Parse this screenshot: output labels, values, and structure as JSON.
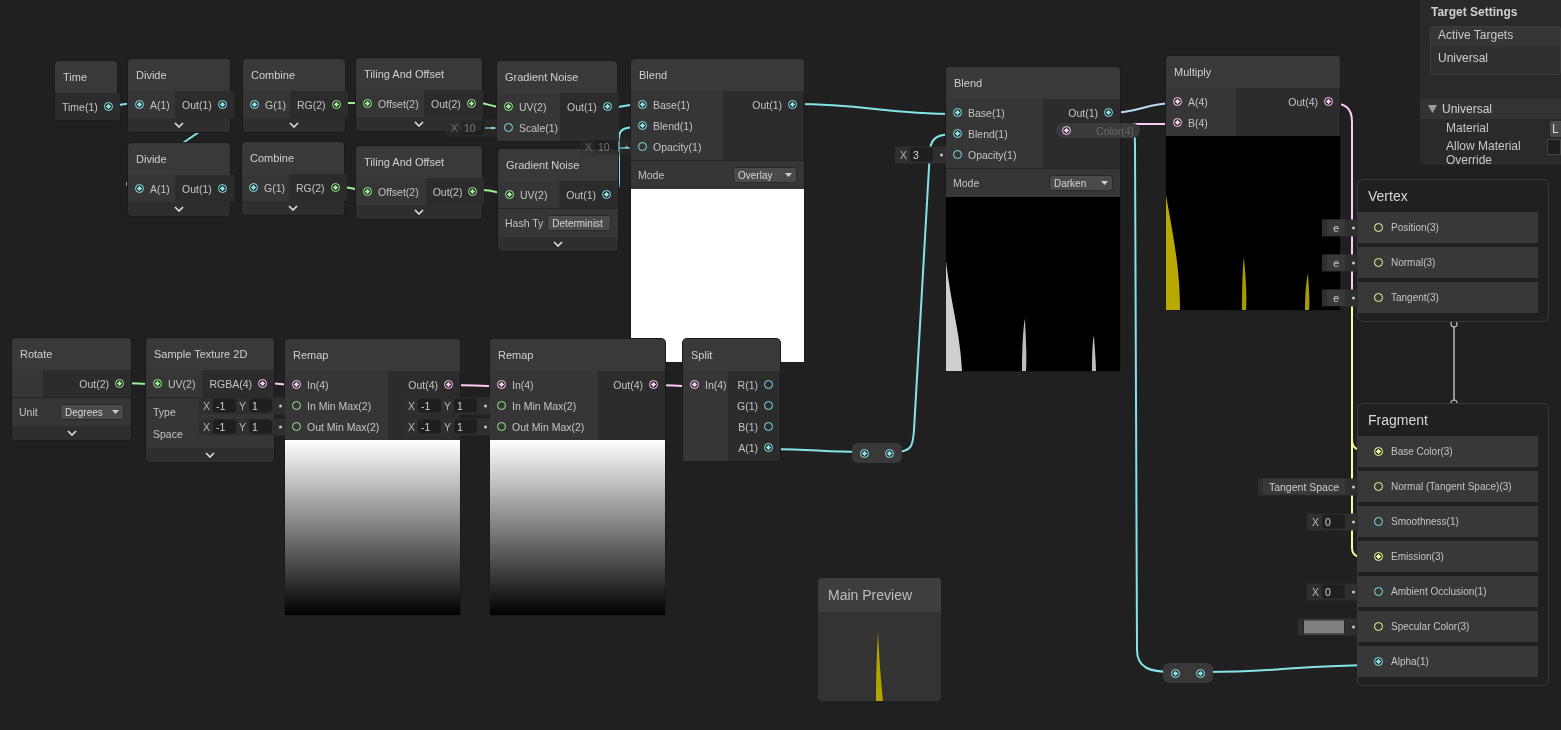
{
  "graph": {
    "nodes": [
      {
        "title": "Time",
        "outputs": [
          {
            "label": "Time(1)",
            "kind": "float",
            "connected": true
          }
        ],
        "expander": false
      },
      {
        "title": "Divide",
        "inputs": [
          {
            "label": "A(1)",
            "kind": "float",
            "connected": true
          }
        ],
        "outputs": [
          {
            "label": "Out(1)",
            "kind": "float",
            "connected": true
          }
        ],
        "expander": true
      },
      {
        "title": "Combine",
        "inputs": [
          {
            "label": "G(1)",
            "kind": "float",
            "connected": true
          }
        ],
        "outputs": [
          {
            "label": "RG(2)",
            "kind": "vec2",
            "connected": true
          }
        ],
        "expander": true
      },
      {
        "title": "Tiling And Offset",
        "inputs": [
          {
            "label": "Offset(2)",
            "kind": "vec2",
            "connected": true
          }
        ],
        "outputs": [
          {
            "label": "Out(2)",
            "kind": "vec2",
            "connected": true
          }
        ],
        "expander": true
      },
      {
        "title": "Gradient Noise",
        "inputs": [
          {
            "label": "UV(2)",
            "kind": "vec2",
            "connected": true
          },
          {
            "label": "Scale(1)",
            "kind": "float",
            "connected": false,
            "field": {
              "kind": "vector",
              "dimmed": true,
              "parts": [
                {
                  "axis": "X",
                  "value": "10"
                }
              ]
            }
          }
        ],
        "outputs": [
          {
            "label": "Out(1)",
            "kind": "float",
            "connected": true
          }
        ],
        "expander": false
      },
      {
        "title": "Blend",
        "inputs": [
          {
            "label": "Base(1)",
            "kind": "float",
            "connected": true
          },
          {
            "label": "Blend(1)",
            "kind": "float",
            "connected": true
          },
          {
            "label": "Opacity(1)",
            "kind": "float",
            "connected": false,
            "field": {
              "kind": "vector",
              "dimmed": true,
              "parts": [
                {
                  "axis": "X",
                  "value": "10"
                }
              ]
            }
          }
        ],
        "outputs": [
          {
            "label": "Out(1)",
            "kind": "float",
            "connected": true
          }
        ],
        "controls": [
          {
            "label": "Mode",
            "value": "Overlay"
          }
        ],
        "preview": {
          "kind": "white"
        },
        "expander": false
      },
      {
        "title": "Divide",
        "inputs": [
          {
            "label": "A(1)",
            "kind": "float",
            "connected": true
          }
        ],
        "outputs": [
          {
            "label": "Out(1)",
            "kind": "float",
            "connected": true
          }
        ],
        "expander": true
      },
      {
        "title": "Combine",
        "inputs": [
          {
            "label": "G(1)",
            "kind": "float",
            "connected": true
          }
        ],
        "outputs": [
          {
            "label": "RG(2)",
            "kind": "vec2",
            "connected": true
          }
        ],
        "expander": true
      },
      {
        "title": "Tiling And Offset",
        "inputs": [
          {
            "label": "Offset(2)",
            "kind": "vec2",
            "connected": true
          }
        ],
        "outputs": [
          {
            "label": "Out(2)",
            "kind": "vec2",
            "connected": true
          }
        ],
        "expander": true
      },
      {
        "title": "Gradient Noise",
        "inputs": [
          {
            "label": "UV(2)",
            "kind": "vec2",
            "connected": true
          }
        ],
        "outputs": [
          {
            "label": "Out(1)",
            "kind": "float",
            "connected": true
          }
        ],
        "controls": [
          {
            "label": "Hash Ty",
            "value": "Determinist"
          }
        ],
        "expander": true
      },
      {
        "title": "Blend",
        "inputs": [
          {
            "label": "Base(1)",
            "kind": "float",
            "connected": true
          },
          {
            "label": "Blend(1)",
            "kind": "float",
            "connected": true
          },
          {
            "label": "Opacity(1)",
            "kind": "float",
            "connected": false,
            "field": {
              "kind": "vector",
              "dimmed": false,
              "parts": [
                {
                  "axis": "X",
                  "value": "3"
                }
              ]
            }
          }
        ],
        "outputs": [
          {
            "label": "Out(1)",
            "kind": "float",
            "connected": true
          }
        ],
        "controls": [
          {
            "label": "Mode",
            "value": "Darken"
          }
        ],
        "preview": {
          "kind": "streaks-white"
        },
        "expander": false
      },
      {
        "title": "Multiply",
        "inputs": [
          {
            "label": "A(4)",
            "kind": "vec4",
            "connected": true
          },
          {
            "label": "B(4)",
            "kind": "vec4",
            "connected": true
          }
        ],
        "outputs": [
          {
            "label": "Out(4)",
            "kind": "vec4",
            "connected": true
          }
        ],
        "preview": {
          "kind": "streaks-yellow"
        },
        "expander": false
      },
      {
        "title": "Rotate",
        "outputs": [
          {
            "label": "Out(2)",
            "kind": "vec2",
            "connected": true
          }
        ],
        "controls": [
          {
            "label": "Unit",
            "value": "Degrees"
          }
        ],
        "expander": true
      },
      {
        "title": "Sample Texture 2D",
        "inputs": [
          {
            "label": "UV(2)",
            "kind": "vec2",
            "connected": true
          }
        ],
        "outputs": [
          {
            "label": "RGBA(4)",
            "kind": "vec4",
            "connected": true
          }
        ],
        "controls": [
          {
            "label": "Type"
          },
          {
            "label": "Space"
          }
        ],
        "expander": true
      },
      {
        "title": "Remap",
        "inputs": [
          {
            "label": "In(4)",
            "kind": "vec4",
            "connected": true
          },
          {
            "label": "In Min Max(2)",
            "kind": "vec2",
            "connected": false,
            "field": {
              "kind": "vector",
              "dimmed": false,
              "parts": [
                {
                  "axis": "X",
                  "value": "-1"
                },
                {
                  "axis": "Y",
                  "value": "1"
                }
              ]
            }
          },
          {
            "label": "Out Min Max(2)",
            "kind": "vec2",
            "connected": false,
            "field": {
              "kind": "vector",
              "dimmed": false,
              "parts": [
                {
                  "axis": "X",
                  "value": "-1"
                },
                {
                  "axis": "Y",
                  "value": "1"
                }
              ]
            }
          }
        ],
        "outputs": [
          {
            "label": "Out(4)",
            "kind": "vec4",
            "connected": true
          }
        ],
        "preview": {
          "kind": "gradient"
        },
        "expander": false
      },
      {
        "title": "Remap",
        "inputs": [
          {
            "label": "In(4)",
            "kind": "vec4",
            "connected": true
          },
          {
            "label": "In Min Max(2)",
            "kind": "vec2",
            "connected": false,
            "field": {
              "kind": "vector",
              "dimmed": false,
              "parts": [
                {
                  "axis": "X",
                  "value": "-1"
                },
                {
                  "axis": "Y",
                  "value": "1"
                }
              ]
            }
          },
          {
            "label": "Out Min Max(2)",
            "kind": "vec2",
            "connected": false,
            "field": {
              "kind": "vector",
              "dimmed": false,
              "parts": [
                {
                  "axis": "X",
                  "value": "-1"
                },
                {
                  "axis": "Y",
                  "value": "1"
                }
              ]
            }
          }
        ],
        "outputs": [
          {
            "label": "Out(4)",
            "kind": "vec4",
            "connected": true
          }
        ],
        "preview": {
          "kind": "gradient"
        },
        "expander": false
      },
      {
        "title": "Split",
        "inputs": [
          {
            "label": "In(4)",
            "kind": "vec4",
            "connected": true
          }
        ],
        "outputs": [
          {
            "label": "R(1)",
            "kind": "float",
            "connected": false
          },
          {
            "label": "G(1)",
            "kind": "float",
            "connected": false
          },
          {
            "label": "B(1)",
            "kind": "float",
            "connected": false
          },
          {
            "label": "A(1)",
            "kind": "float",
            "connected": true
          }
        ],
        "expander": false
      }
    ],
    "floating_port": {
      "label": "Color(4)",
      "kind": "vec4"
    },
    "stacks": [
      {
        "title": "Vertex",
        "slots": [
          {
            "label": "Position(3)",
            "kind": "vec3",
            "connected": false,
            "field": {
              "kind": "text",
              "text": "e"
            }
          },
          {
            "label": "Normal(3)",
            "kind": "vec3",
            "connected": false,
            "field": {
              "kind": "text",
              "text": "e"
            }
          },
          {
            "label": "Tangent(3)",
            "kind": "vec3",
            "connected": false,
            "field": {
              "kind": "text",
              "text": "e"
            }
          }
        ]
      },
      {
        "title": "Fragment",
        "slots": [
          {
            "label": "Base Color(3)",
            "kind": "vec3",
            "connected": true
          },
          {
            "label": "Normal (Tangent Space)(3)",
            "kind": "vec3",
            "connected": false,
            "field": {
              "kind": "text",
              "text": "Tangent Space"
            }
          },
          {
            "label": "Smoothness(1)",
            "kind": "float",
            "connected": false,
            "field": {
              "kind": "vector",
              "dimmed": false,
              "parts": [
                {
                  "axis": "X",
                  "value": "0"
                }
              ]
            }
          },
          {
            "label": "Emission(3)",
            "kind": "vec3",
            "connected": true
          },
          {
            "label": "Ambient Occlusion(1)",
            "kind": "float",
            "connected": false,
            "field": {
              "kind": "vector",
              "dimmed": false,
              "parts": [
                {
                  "axis": "X",
                  "value": "0"
                }
              ]
            }
          },
          {
            "label": "Specular Color(3)",
            "kind": "vec3",
            "connected": false,
            "field": {
              "kind": "color",
              "color": "#808080"
            }
          },
          {
            "label": "Alpha(1)",
            "kind": "float",
            "connected": true
          }
        ]
      }
    ]
  },
  "target_settings": {
    "title": "Target Settings",
    "list_header": "Active Targets",
    "targets": [
      "Universal"
    ],
    "section": {
      "title": "Universal",
      "expanded": true,
      "properties": [
        {
          "label": "Material",
          "kind": "dropdown",
          "value": "L"
        },
        {
          "label": "Allow Material Override",
          "kind": "checkbox",
          "checked": false
        }
      ]
    }
  },
  "main_preview": {
    "title": "Main Preview"
  }
}
